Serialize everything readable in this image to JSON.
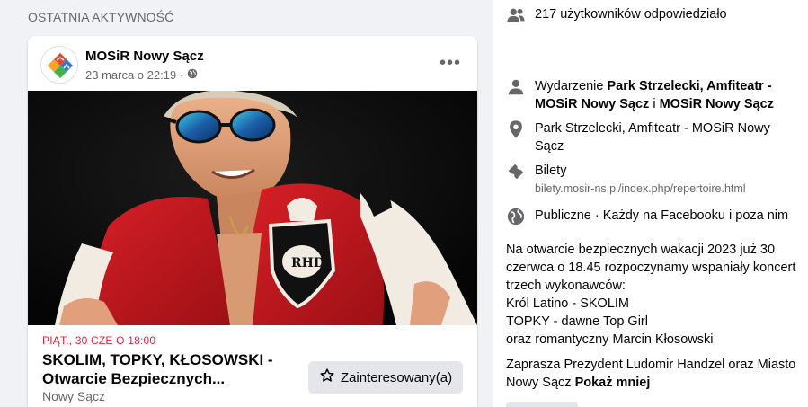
{
  "left": {
    "section_title": "OSTATNIA AKTYWNOŚĆ",
    "post": {
      "page_name": "MOSiR Nowy Sącz",
      "time": "23 marca o 22:19 ·",
      "more_label": "•••",
      "event_date": "PIĄT., 30 CZE O 18:00",
      "event_title": "SKOLIM, TOPKY, KŁOSOWSKI - Otwarcie Bezpiecznych...",
      "event_location": "Nowy Sącz",
      "interest_button": "Zainteresowany(a)"
    }
  },
  "right": {
    "responded": "217 użytkowników odpowiedziało",
    "host_prefix": "Wydarzenie ",
    "host_name": "Park Strzelecki, Amfiteatr - MOSiR Nowy Sącz",
    "host_join": " i ",
    "host_name2": "MOSiR Nowy Sącz",
    "location_link": "Park Strzelecki, Amfiteatr - MOSiR Nowy Sącz",
    "tickets_label": "Bilety",
    "tickets_url": "bilety.mosir-ns.pl/index.php/repertoire.html",
    "privacy": "Publiczne · Każdy na Facebooku i poza nim",
    "description_p1": "Na otwarcie bezpiecznych wakacji 2023 już 30 czerwca o 18.45 rozpoczynamy wspaniały koncert trzech wykonawców:\nKról Latino - SKOLIM\nTOPKY - dawne Top Girl\noraz romantyczny Marcin Kłosowski",
    "description_p2": "Zaprasza Prezydent Ludomir Handzel oraz Miasto Nowy Sącz ",
    "see_less": "Pokaż mniej"
  },
  "colors": {
    "accent_red": "#e41e3f",
    "link_blue": "#216fdb",
    "muted": "#65676b",
    "icon_gray": "#8a8d91"
  },
  "icons": [
    "people-icon",
    "globe-icon",
    "person-icon",
    "location-pin-icon",
    "ticket-icon",
    "globe-icon",
    "star-icon"
  ]
}
